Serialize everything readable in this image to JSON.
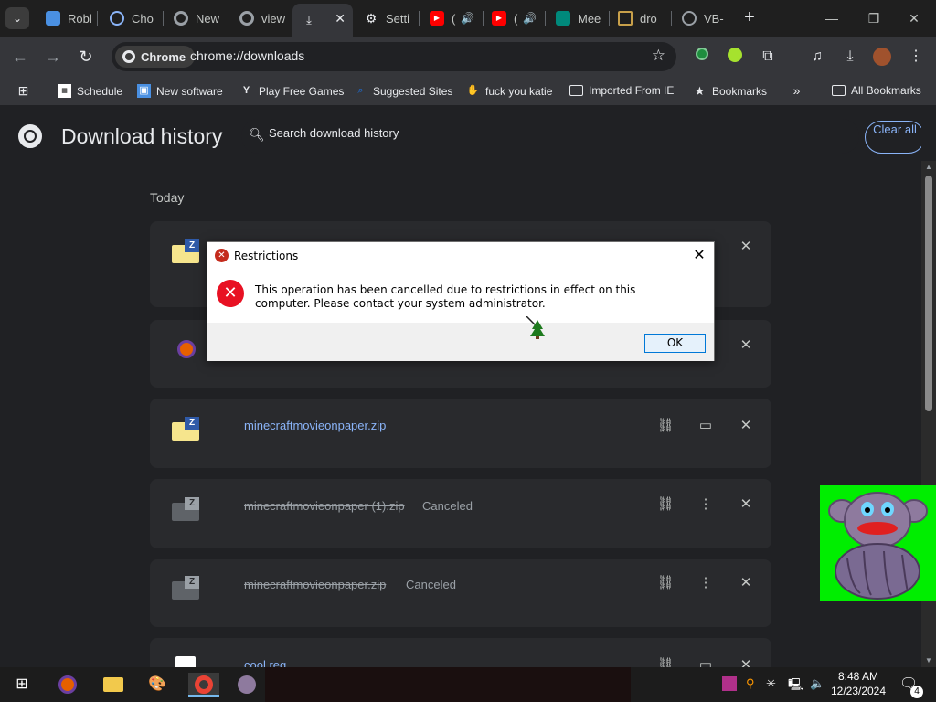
{
  "tabs": [
    {
      "label": "Robl",
      "icon": "roblox-icon",
      "color": "#4a90e2"
    },
    {
      "label": "Cho",
      "icon": "search-tab-icon",
      "color": "#1a73e8"
    },
    {
      "label": "New",
      "icon": "chrome-icon",
      "color": "#9aa0a6"
    },
    {
      "label": "view",
      "icon": "chrome-icon",
      "color": "#9aa0a6"
    },
    {
      "label": "",
      "icon": "download-icon",
      "color": "#e8eaed"
    },
    {
      "label": "Setti",
      "icon": "gear-icon",
      "color": "#e8eaed"
    },
    {
      "label": "(",
      "icon": "youtube-icon",
      "color": "#ff0000"
    },
    {
      "label": "(",
      "icon": "youtube-icon",
      "color": "#ff0000"
    },
    {
      "label": "Mee",
      "icon": "meet-icon",
      "color": "#00897b"
    },
    {
      "label": "dro",
      "icon": "folder-icon",
      "color": "#c8a04a"
    },
    {
      "label": "VB-",
      "icon": "globe-icon",
      "color": "#9aa0a6"
    }
  ],
  "toolbar": {
    "chip_label": "Chrome",
    "url": "chrome://downloads"
  },
  "bookmarks": [
    {
      "label": "Schedule",
      "icon": "schedule-icon"
    },
    {
      "label": "New software",
      "icon": "software-icon"
    },
    {
      "label": "Play Free Games",
      "icon": "games-icon"
    },
    {
      "label": "Suggested Sites",
      "icon": "suggested-icon"
    },
    {
      "label": "fuck you katie",
      "icon": "hand-icon"
    },
    {
      "label": "Imported From IE",
      "icon": "folder-icon"
    },
    {
      "label": "Bookmarks",
      "icon": "star-icon"
    },
    {
      "label": "All Bookmarks",
      "icon": "folder-icon"
    }
  ],
  "page": {
    "title": "Download history",
    "search_placeholder": "Search download history",
    "clear_all": "Clear all",
    "section": "Today"
  },
  "downloads": [
    {
      "name": "",
      "status": "",
      "canceled": false,
      "icon": "zip-icon"
    },
    {
      "name": "",
      "status": "",
      "canceled": false,
      "icon": "firefox-icon"
    },
    {
      "name": "minecraftmovieonpaper.zip",
      "status": "",
      "canceled": false,
      "icon": "zip-icon"
    },
    {
      "name": "minecraftmovieonpaper (1).zip",
      "status": "Canceled",
      "canceled": true,
      "icon": "zip-icon"
    },
    {
      "name": "minecraftmovieonpaper.zip",
      "status": "Canceled",
      "canceled": true,
      "icon": "zip-icon"
    },
    {
      "name": "cool.reg",
      "status": "",
      "canceled": false,
      "icon": "reg-icon"
    }
  ],
  "dialog": {
    "title": "Restrictions",
    "message": "This operation has been cancelled due to restrictions in effect on this computer. Please contact your system administrator.",
    "ok": "OK"
  },
  "taskbar": {
    "time": "8:48 AM",
    "date": "12/23/2024",
    "notifications": "4"
  }
}
